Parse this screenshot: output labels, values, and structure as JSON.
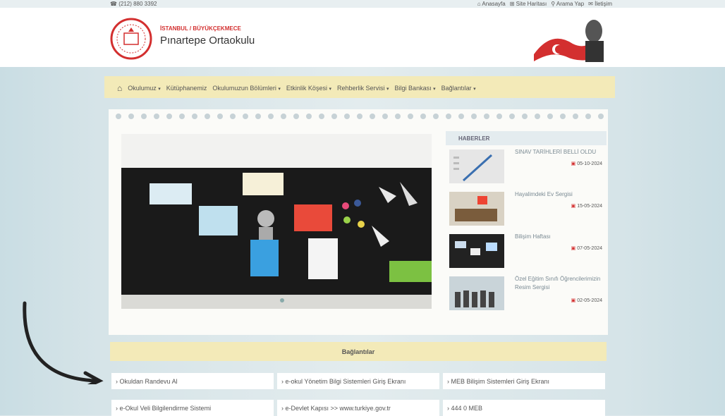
{
  "topbar": {
    "phone": "(212) 880 3392",
    "links": [
      "Anasayfa",
      "Site Haritası",
      "Arama Yap",
      "İletişim"
    ]
  },
  "header": {
    "city": "İSTANBUL / BÜYÜKÇEKMECE",
    "school": "Pınartepe Ortaokulu"
  },
  "nav": {
    "items": [
      "Okulumuz",
      "Kütüphanemiz",
      "Okulumuzun Bölümleri",
      "Etkinlik Köşesi",
      "Rehberlik Servisi",
      "Bilgi Bankası",
      "Bağlantılar"
    ]
  },
  "news": {
    "header": "HABERLER",
    "items": [
      {
        "title": "SINAV TARİHLERİ BELLİ OLDU",
        "date": "05-10-2024"
      },
      {
        "title": "Hayalimdeki Ev Sergisi",
        "date": "15-05-2024"
      },
      {
        "title": "Bilişim Haftası",
        "date": "07-05-2024"
      },
      {
        "title": "Özel Eğitim Sınıfı Öğrencilerimizin Resim Sergisi",
        "date": "02-05-2024"
      }
    ]
  },
  "links": {
    "title": "Bağlantılar",
    "items": [
      "Okuldan Randevu Al",
      "e-okul Yönetim Bilgi Sistemleri Giriş Ekranı",
      "MEB Bilişim Sistemleri Giriş Ekranı",
      "e-Okul Veli Bilgilendirme Sistemi",
      "e-Devlet Kapısı >> www.turkiye.gov.tr",
      "444 0 MEB"
    ]
  },
  "colors": {
    "accent": "#d32f2f",
    "nav_bg": "#f3eab8"
  }
}
